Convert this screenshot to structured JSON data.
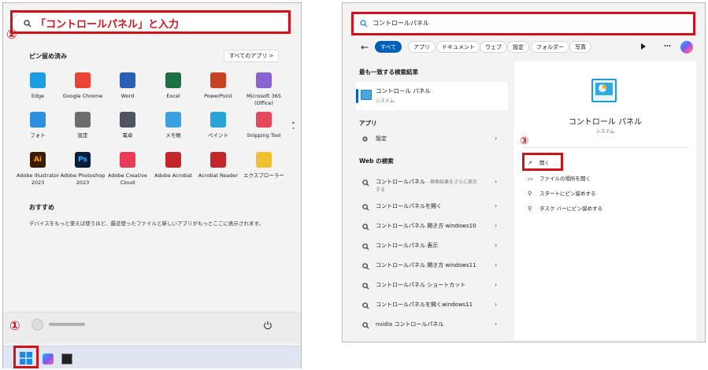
{
  "left": {
    "search_text": "「コントロールパネル」と入力",
    "step_search": "②",
    "pinned_title": "ピン留め済み",
    "all_apps": "すべてのアプリ  >",
    "apps": [
      {
        "label": "Edge",
        "icon": "edge-icon",
        "color": "#1b9de2"
      },
      {
        "label": "Google Chrome",
        "icon": "chrome-icon",
        "color": "#e94335"
      },
      {
        "label": "Word",
        "icon": "word-icon",
        "color": "#2b5fb3"
      },
      {
        "label": "Excel",
        "icon": "excel-icon",
        "color": "#1d7044"
      },
      {
        "label": "PowerPoint",
        "icon": "powerpoint-icon",
        "color": "#c74322"
      },
      {
        "label": "Microsoft 365 (Office)",
        "icon": "m365-icon",
        "color": "#8a63d2"
      },
      {
        "label": "フォト",
        "icon": "photos-icon",
        "color": "#2d8fe0"
      },
      {
        "label": "設定",
        "icon": "settings-icon",
        "color": "#6d6d6d"
      },
      {
        "label": "電卓",
        "icon": "calculator-icon",
        "color": "#4e5560"
      },
      {
        "label": "メモ帳",
        "icon": "notepad-icon",
        "color": "#3aa0e0"
      },
      {
        "label": "ペイント",
        "icon": "paint-icon",
        "color": "#2aa4d8"
      },
      {
        "label": "Snipping Tool",
        "icon": "snipping-icon",
        "color": "#e6495a"
      },
      {
        "label": "Adobe Illustrator 2023",
        "icon": "illustrator-icon",
        "color": "#3a1c00",
        "glyph": "Ai"
      },
      {
        "label": "Adobe Photoshop 2023",
        "icon": "photoshop-icon",
        "color": "#061e3c",
        "glyph": "Ps"
      },
      {
        "label": "Adobe Creative Cloud",
        "icon": "creative-cloud-icon",
        "color": "#e83b5a"
      },
      {
        "label": "Adobe Acrobat",
        "icon": "acrobat-icon",
        "color": "#c3272b"
      },
      {
        "label": "Acrobat Reader",
        "icon": "acrobat-reader-icon",
        "color": "#c3272b"
      },
      {
        "label": "エクスプローラー",
        "icon": "explorer-icon",
        "color": "#f1c031"
      }
    ],
    "recommended_title": "おすすめ",
    "recommended_text": "デバイスをもっと使えば使うほど、最近使ったファイルと新しいアプリがもっとここに表示されます。",
    "step_start": "①"
  },
  "right": {
    "search_text": "コントロールパネル",
    "filters": [
      "すべて",
      "アプリ",
      "ドキュメント",
      "ウェブ",
      "設定",
      "フォルダー",
      "写真"
    ],
    "more": "…",
    "best_match_title": "最も一致する検索結果",
    "best_match_name": "コントロール パネル",
    "best_match_sub": "システム",
    "apps_title": "アプリ",
    "apps": [
      {
        "label": "設定"
      }
    ],
    "web_title": "Web の検索",
    "web": [
      {
        "label": "コントロールパネル",
        "sub": " - 検索結果をさらに表示",
        "sub2": "する"
      },
      {
        "label": "コントロールパネルを開く"
      },
      {
        "label": "コントロールパネル 開き方 windows10"
      },
      {
        "label": "コントロールパネル 表示"
      },
      {
        "label": "コントロールパネル 開き方 windows11"
      },
      {
        "label": "コントロールパネル ショートカット"
      },
      {
        "label": "コントロールパネルを開くwindows11"
      },
      {
        "label": "nvidia コントロールパネル"
      }
    ],
    "detail_name": "コントロール パネル",
    "detail_sub": "システム",
    "step_open": "③",
    "actions": [
      {
        "label": "開く",
        "icon": "open-icon"
      },
      {
        "label": "ファイルの場所を開く",
        "icon": "folder-icon"
      },
      {
        "label": "スタートにピン留めする",
        "icon": "pin-icon"
      },
      {
        "label": "タスク バーにピン留めする",
        "icon": "pin-icon"
      }
    ]
  }
}
